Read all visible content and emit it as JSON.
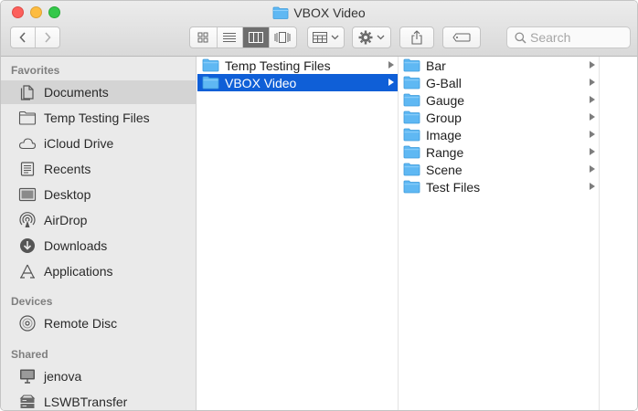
{
  "window": {
    "title": "VBOX Video"
  },
  "toolbar": {
    "back_icon": "chevron-left-icon",
    "forward_icon": "chevron-right-icon",
    "view_modes": [
      "icon-view-icon",
      "list-view-icon",
      "column-view-icon",
      "cover-flow-icon"
    ],
    "active_view": "column-view-icon",
    "arrange_icon": "arrange-grid-icon",
    "action_icon": "gear-icon",
    "share_icon": "share-icon",
    "tags_icon": "tag-icon",
    "search_placeholder": "Search"
  },
  "sidebar": {
    "sections": [
      {
        "title": "Favorites",
        "items": [
          {
            "label": "Documents",
            "icon": "documents-icon",
            "selected": true
          },
          {
            "label": "Temp Testing Files",
            "icon": "folder-icon"
          },
          {
            "label": "iCloud Drive",
            "icon": "cloud-icon"
          },
          {
            "label": "Recents",
            "icon": "recents-icon"
          },
          {
            "label": "Desktop",
            "icon": "desktop-icon"
          },
          {
            "label": "AirDrop",
            "icon": "airdrop-icon"
          },
          {
            "label": "Downloads",
            "icon": "downloads-icon"
          },
          {
            "label": "Applications",
            "icon": "applications-icon"
          }
        ]
      },
      {
        "title": "Devices",
        "items": [
          {
            "label": "Remote Disc",
            "icon": "disc-icon"
          }
        ]
      },
      {
        "title": "Shared",
        "items": [
          {
            "label": "jenova",
            "icon": "computer-icon"
          },
          {
            "label": "LSWBTransfer",
            "icon": "server-icon"
          }
        ]
      }
    ]
  },
  "columns": [
    {
      "items": [
        {
          "label": "Temp Testing Files",
          "selected": false
        },
        {
          "label": "VBOX Video",
          "selected": true
        }
      ]
    },
    {
      "items": [
        {
          "label": "Bar"
        },
        {
          "label": "G-Ball"
        },
        {
          "label": "Gauge"
        },
        {
          "label": "Group"
        },
        {
          "label": "Image"
        },
        {
          "label": "Range"
        },
        {
          "label": "Scene"
        },
        {
          "label": "Test Files"
        }
      ]
    }
  ],
  "colors": {
    "selection": "#0f5fd7",
    "folder": "#5fb8f3",
    "sidebar_bg": "#eaeaea"
  }
}
